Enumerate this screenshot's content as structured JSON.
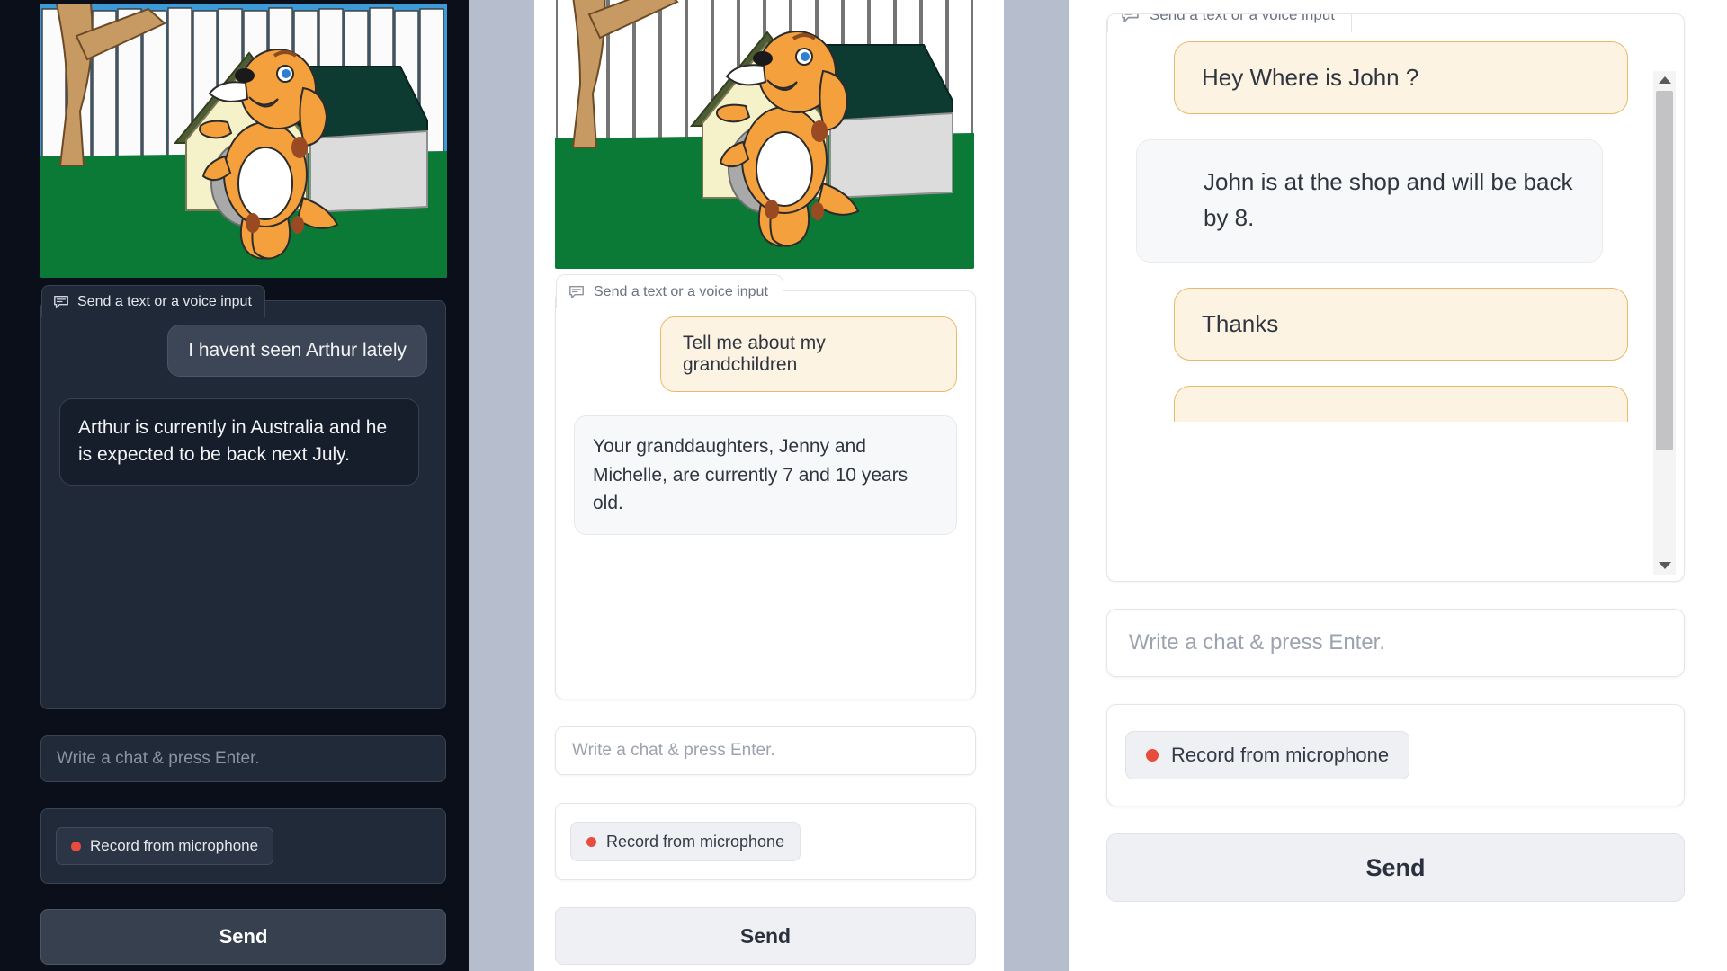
{
  "theme": {
    "page_background": "#b6bdcd",
    "dark_panel_bg": "#0b0f19",
    "light_panel_bg": "#ffffff",
    "user_bubble_accent": "#e9b96b",
    "user_bubble_fill": "#fdf3e3",
    "record_dot_color": "#e74c3c"
  },
  "common": {
    "input_chip_label": "Send a text or a voice input",
    "chat_input_placeholder": "Write a chat & press Enter.",
    "record_button_label": "Record from microphone",
    "send_button_label": "Send",
    "chat_icon_name": "chat-bubble-icon",
    "mic_icon_name": "record-dot-icon"
  },
  "panels": [
    {
      "id": "dark-panel",
      "theme": "dark",
      "hero_alt": "cartoon dog standing in front of a doghouse with a white picket fence and tree",
      "messages": [
        {
          "role": "user",
          "text": "I havent seen Arthur lately"
        },
        {
          "role": "assistant",
          "text": "Arthur is currently in Australia and he is expected to be back next July."
        }
      ]
    },
    {
      "id": "light-panel",
      "theme": "light",
      "hero_alt": "cartoon dog standing in front of a doghouse with a white picket fence and tree",
      "messages": [
        {
          "role": "user",
          "text": "Tell me about my grandchildren"
        },
        {
          "role": "assistant",
          "text": "Your granddaughters, Jenny and Michelle, are currently 7 and 10 years old."
        }
      ]
    },
    {
      "id": "wide-panel",
      "theme": "light",
      "messages": [
        {
          "role": "user",
          "text": "Hey Where is John ?"
        },
        {
          "role": "assistant",
          "text": "John is at the shop and will be back by 8."
        },
        {
          "role": "user",
          "text": "Thanks"
        }
      ],
      "scrollbar": {
        "up_arrow": "scroll-up-arrow",
        "down_arrow": "scroll-down-arrow",
        "thumb_position_percent": 0,
        "thumb_size_percent": 82
      }
    }
  ]
}
